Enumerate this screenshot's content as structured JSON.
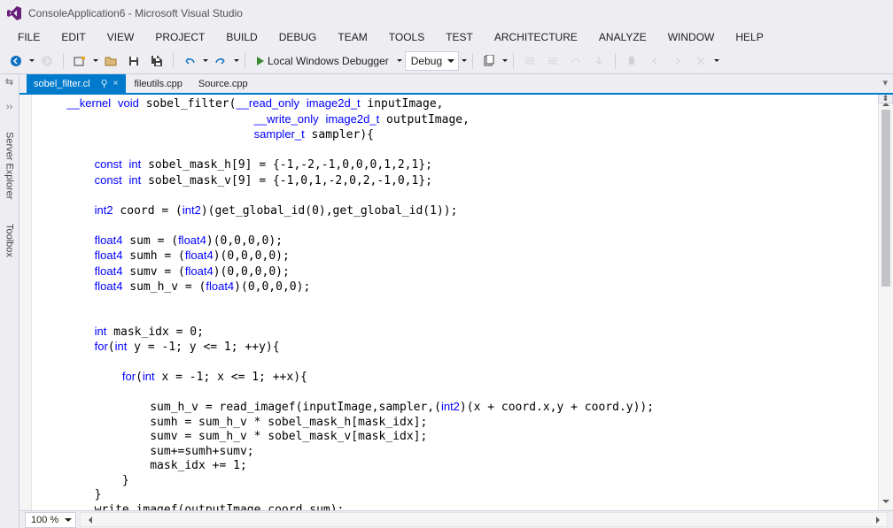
{
  "title": "ConsoleApplication6 - Microsoft Visual Studio",
  "menubar": [
    "FILE",
    "EDIT",
    "VIEW",
    "PROJECT",
    "BUILD",
    "DEBUG",
    "TEAM",
    "TOOLS",
    "TEST",
    "ARCHITECTURE",
    "ANALYZE",
    "WINDOW",
    "HELP"
  ],
  "toolbar": {
    "debugger_label": "Local Windows Debugger",
    "config": "Debug"
  },
  "side_tabs": [
    "Server Explorer",
    "Toolbox"
  ],
  "doc_tabs": [
    {
      "label": "sobel_filter.cl",
      "active": true,
      "pinned": true
    },
    {
      "label": "fileutils.cpp",
      "active": false
    },
    {
      "label": "Source.cpp",
      "active": false
    }
  ],
  "zoom": "100 %",
  "code": "__kernel void sobel_filter(__read_only image2d_t inputImage,\n                           __write_only image2d_t outputImage,\n                           sampler_t sampler){\n\n    const int sobel_mask_h[9] = {-1,-2,-1,0,0,0,1,2,1};\n    const int sobel_mask_v[9] = {-1,0,1,-2,0,2,-1,0,1};\n\n    int2 coord = (int2)(get_global_id(0),get_global_id(1));\n\n    float4 sum = (float4)(0,0,0,0);\n    float4 sumh = (float4)(0,0,0,0);\n    float4 sumv = (float4)(0,0,0,0);\n    float4 sum_h_v = (float4)(0,0,0,0);\n\n\n    int mask_idx = 0;\n    for(int y = -1; y <= 1; ++y){\n\n        for(int x = -1; x <= 1; ++x){\n\n            sum_h_v = read_imagef(inputImage,sampler,(int2)(x + coord.x,y + coord.y));\n            sumh = sum_h_v * sobel_mask_h[mask_idx];\n            sumv = sum_h_v * sobel_mask_v[mask_idx];\n            sum+=sumh+sumv;\n            mask_idx += 1;\n        }\n    }\n    write_imagef(outputImage,coord,sum);\n}"
}
